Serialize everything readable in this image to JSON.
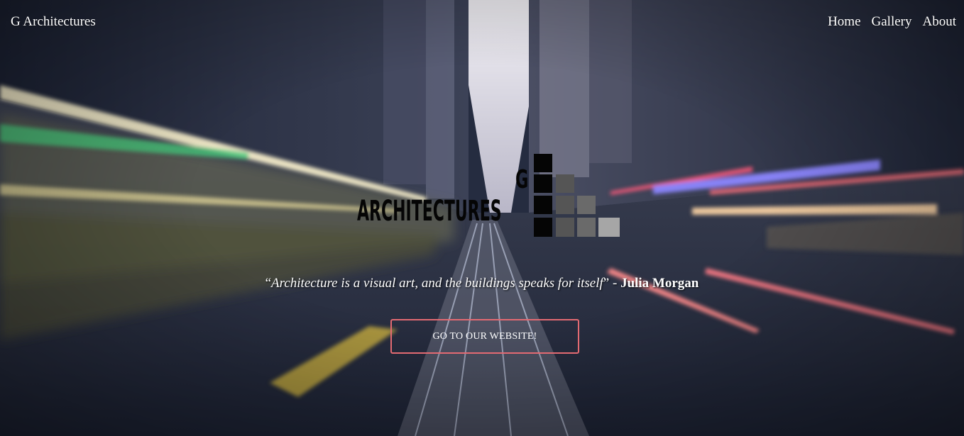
{
  "navbar": {
    "brand": "G Architectures",
    "links": [
      "Home",
      "Gallery",
      "About"
    ]
  },
  "hero": {
    "logo_letter": "G",
    "logo_word": "ARCHITECTURES",
    "quote_open": "“",
    "quote_text": "Architecture is a visual art, and the buildings speaks for itself",
    "quote_close": "” - ",
    "quote_author": "Julia Morgan",
    "cta_label": "GO TO OUR WEBSITE!"
  },
  "colors": {
    "background": "#232b3e",
    "cta_border": "#e36a72",
    "text": "#ffffff"
  },
  "background_image": "blurred city street with elevated train tracks and motion light trails"
}
